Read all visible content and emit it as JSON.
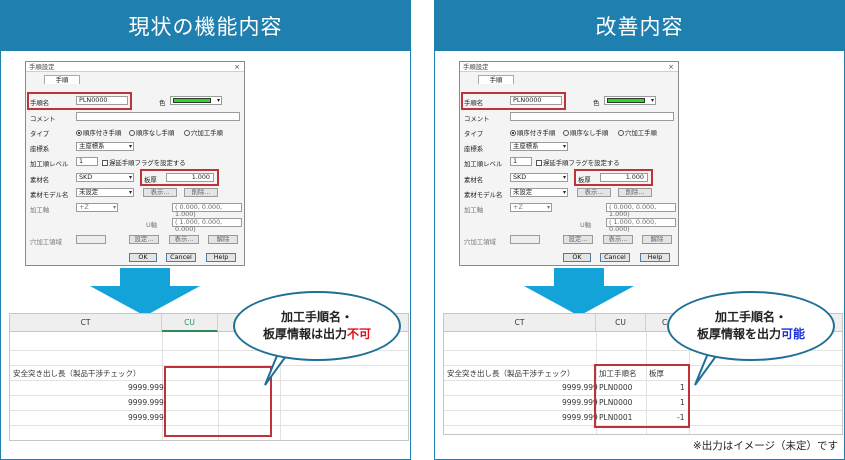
{
  "left": {
    "heading": "現状の機能内容",
    "bubble_line1": "加工手順名・",
    "bubble_line2": "板厚情報は出力",
    "bubble_emph": "不可",
    "sheet": {
      "col_ct": "CT",
      "col_cu": "CU",
      "row_label": "安全突き出し長（製品干渉チェック）",
      "values": [
        "9999.999",
        "9999.999",
        "9999.999"
      ]
    }
  },
  "right": {
    "heading": "改善内容",
    "bubble_line1": "加工手順名・",
    "bubble_line2": "板厚情報を出力",
    "bubble_emph": "可能",
    "sheet": {
      "col_ct": "CT",
      "col_cu": "CU",
      "col_cv": "C",
      "row_label": "安全突き出し長（製品干渉チェック）",
      "header_name": "加工手順名",
      "header_thk": "板厚",
      "rows": [
        {
          "value": "9999.999",
          "name": "PLN0000",
          "thk": "1"
        },
        {
          "value": "9999.999",
          "name": "PLN0000",
          "thk": "1"
        },
        {
          "value": "9999.999",
          "name": "PLN0001",
          "thk": "-1"
        }
      ]
    },
    "note": "※出力はイメージ（未定）です"
  },
  "dialog": {
    "title": "手順設定",
    "close": "×",
    "tab": "手順",
    "name_label": "手順名",
    "name_value": "PLN0000",
    "color_label": "色",
    "color_value": "#22dd22",
    "comment_label": "コメント",
    "type_label": "タイプ",
    "type_opt1": "順序付き手順",
    "type_opt2": "順序なし手順",
    "type_opt3": "穴加工手順",
    "coord_label": "座標系",
    "coord_value": "主座標系",
    "level_label": "加工順レベル",
    "level_value": "1",
    "delay_label": "遅延手順フラグを設定する",
    "material_label": "素材名",
    "material_value": "SKD",
    "thickness_label": "板厚",
    "thickness_value": "1.000",
    "model_label": "素材モデル名",
    "model_value": "未設定",
    "show_btn": "表示...",
    "delete_btn": "削除...",
    "axis_label": "加工軸",
    "axis_value": "+Z",
    "axis_vec1": "( 0.000, 0.000, 1.000)",
    "u_label": "U軸",
    "axis_vec2": "( 1.000, 0.000, 0.000)",
    "hole_label": "穴加工領域",
    "set_btn": "設定...",
    "show_btn2": "表示...",
    "release_btn": "解除",
    "ok": "OK",
    "cancel": "Cancel",
    "help": "Help"
  }
}
